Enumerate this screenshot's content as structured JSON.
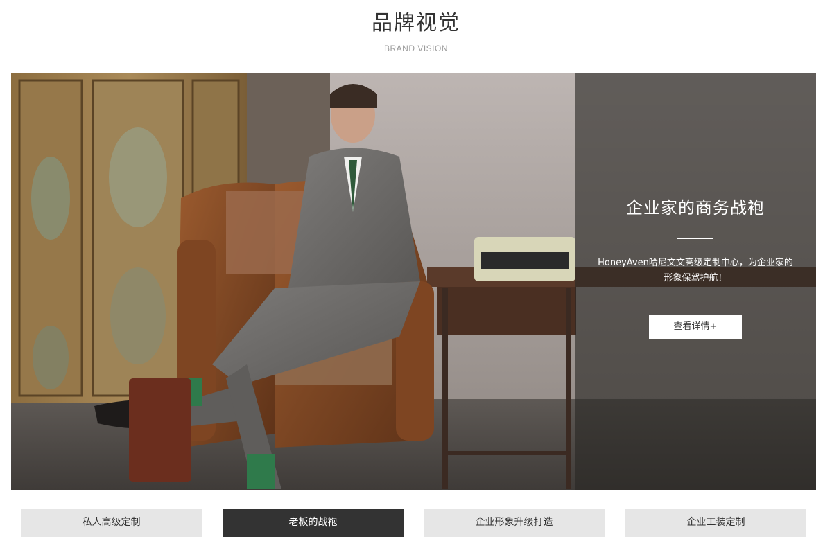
{
  "header": {
    "title": "品牌视觉",
    "subtitle": "BRAND VISION"
  },
  "banner": {
    "heading": "企业家的商务战袍",
    "description": "HoneyAven哈尼文文高级定制中心，为企业家的形象保驾护航！",
    "detail_button": "查看详情+"
  },
  "tabs": [
    {
      "label": "私人高级定制",
      "active": false
    },
    {
      "label": "老板的战袍",
      "active": true
    },
    {
      "label": "企业形象升级打造",
      "active": false
    },
    {
      "label": "企业工装定制",
      "active": false
    }
  ],
  "colors": {
    "active_tab_bg": "#333333",
    "inactive_tab_bg": "#e6e6e6",
    "overlay_bg": "#282624"
  }
}
